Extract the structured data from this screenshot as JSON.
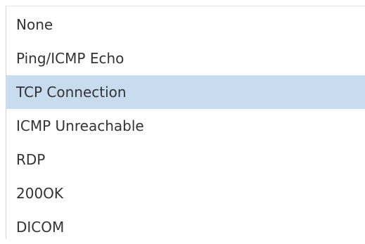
{
  "dropdown": {
    "options": [
      {
        "label": "None"
      },
      {
        "label": "Ping/ICMP Echo"
      },
      {
        "label": "TCP Connection"
      },
      {
        "label": "ICMP Unreachable"
      },
      {
        "label": "RDP"
      },
      {
        "label": "200OK"
      },
      {
        "label": "DICOM"
      }
    ],
    "selected_index": 2,
    "highlight_color": "#c8dcef",
    "text_color": "#333333"
  }
}
